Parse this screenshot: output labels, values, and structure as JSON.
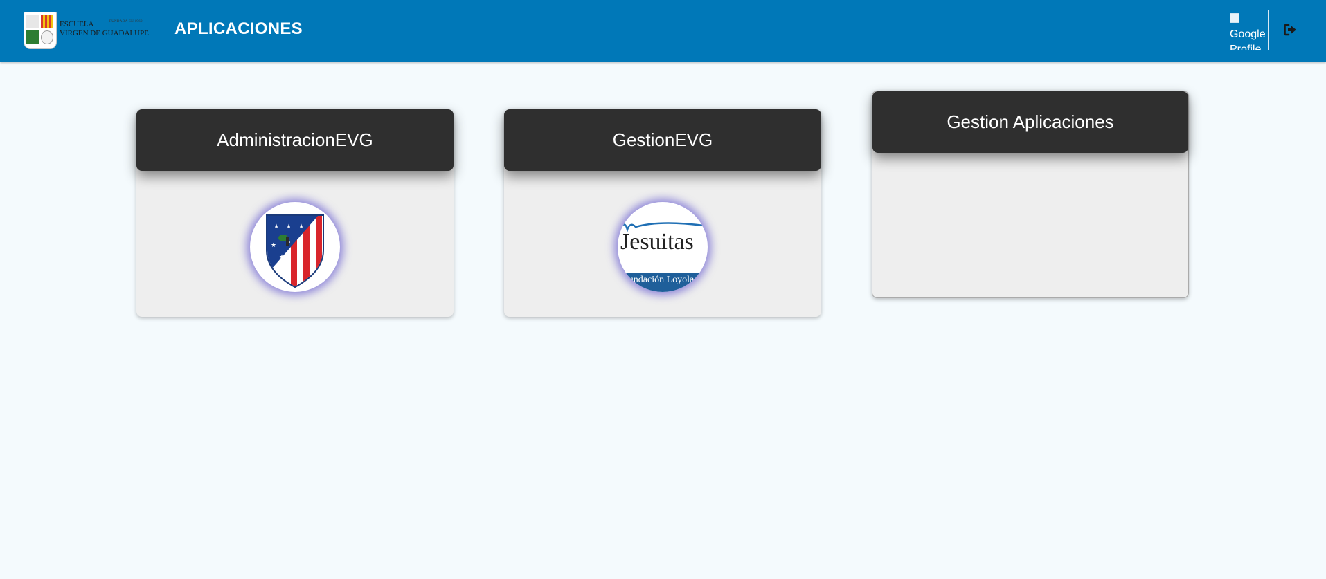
{
  "header": {
    "title": "APLICACIONES",
    "logo_lines": [
      "ESCUELA",
      "VIRGEN DE GUADALUPE"
    ],
    "logo_small": "FUNDADA EN 1960",
    "profile_alt": "Google Profile",
    "logout_icon": "sign-out-icon"
  },
  "apps": [
    {
      "title": "AdministracionEVG",
      "image": "atletico-crest"
    },
    {
      "title": "GestionEVG",
      "image": "jesuitas-logo",
      "image_text": "Jesuitas",
      "image_band": "Fundación Loyola"
    },
    {
      "title": "Gestion Aplicaciones",
      "image": ""
    }
  ],
  "colors": {
    "header_bg": "#0078b8",
    "page_bg": "#f4fafd",
    "card_head": "#2f2f2f",
    "card_body": "#eeeeee",
    "badge_glow": "#4637c8"
  }
}
